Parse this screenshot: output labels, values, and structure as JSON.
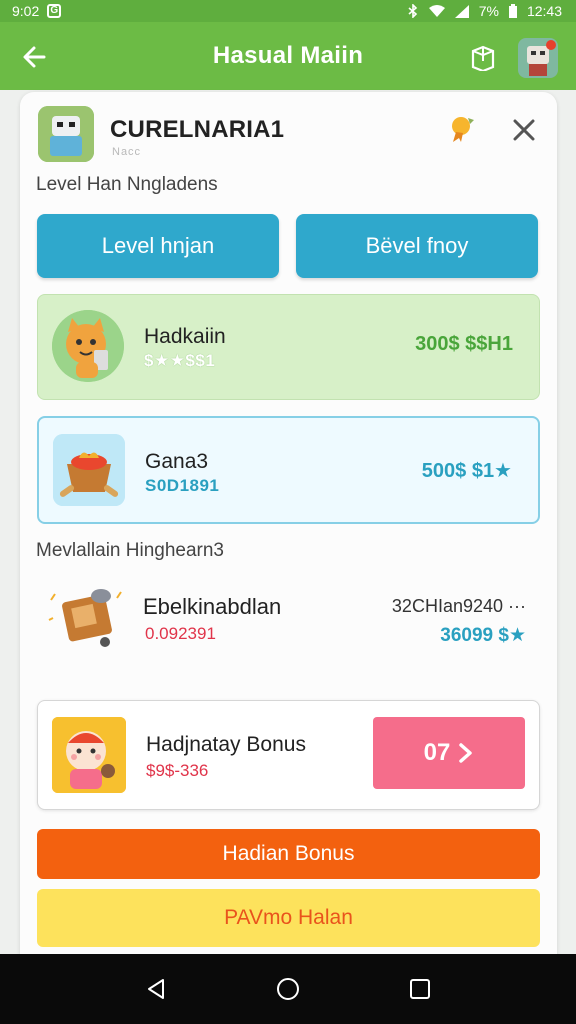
{
  "status_bar": {
    "time_left": "9:02",
    "battery": "7%",
    "time_right": "12:43",
    "icons": [
      "g-icon",
      "bluetooth-icon",
      "wifi-icon",
      "signal-icon",
      "battery-icon"
    ]
  },
  "app_bar": {
    "title": "Hasual Maiin",
    "back_icon": "arrow-left-icon",
    "share_icon": "share-icon",
    "avatar_icon": "robot-avatar-icon"
  },
  "profile": {
    "name": "CURELNARIA1",
    "sub": "Nacc",
    "badge_icon": "ribbon-badge-icon",
    "close_icon": "close-icon"
  },
  "section1_label": "Level Han Nngladens",
  "buttons": {
    "left": "Level hnjan",
    "right": "Bëvel fnoy"
  },
  "offers": [
    {
      "title": "Hadkaiin",
      "sub": "$★★$$1",
      "price": "300$ $$H1",
      "icon": "cat-mascot-icon",
      "accent": "#49a53a"
    },
    {
      "title": "Gana3",
      "sub": "S0D1891",
      "price": "500$ $1★",
      "icon": "treasure-basket-icon",
      "accent": "#2aa0c0"
    }
  ],
  "section2_label": "Mevlallain Hinghearn3",
  "row_item": {
    "title": "Ebelkinabdlan",
    "sub": "0.092391",
    "extra": "32CHIan9240 ···",
    "price": "36099 $★",
    "icon": "scroll-chest-icon"
  },
  "bonus": {
    "title": "Hadjnatay Bonus",
    "sub": "$9$-336",
    "button_label": "07",
    "icon": "character-bonus-icon",
    "button_icon": "chevron-right-icon"
  },
  "action_orange": "Hadian Bonus",
  "action_yellow": "PAVmo Halan",
  "nav": {
    "back": "back-triangle-icon",
    "home": "home-circle-icon",
    "recents": "recents-square-icon"
  },
  "colors": {
    "app_bar": "#6cbb45",
    "blue_button": "#2fa8cc",
    "orange_button": "#f3610f",
    "yellow_button": "#fde25c",
    "pink_button": "#f56d8b"
  }
}
